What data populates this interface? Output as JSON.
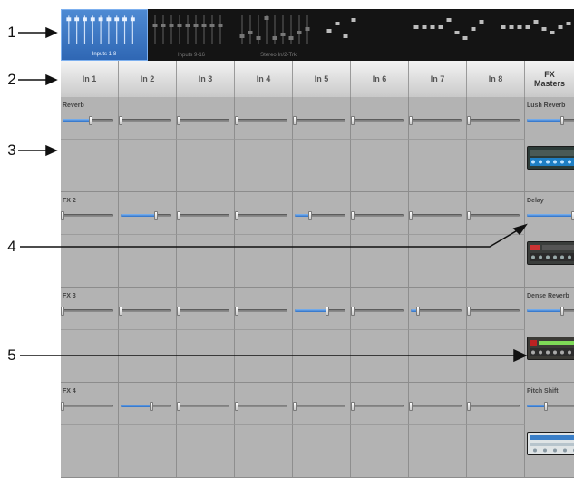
{
  "callouts": [
    "1",
    "2",
    "3",
    "4",
    "5"
  ],
  "tabs": [
    {
      "label": "Inputs 1-8",
      "active": true
    },
    {
      "label": "Inputs 9-16",
      "active": false
    },
    {
      "label": "Stereo In/2-Trk",
      "active": false
    },
    {
      "label": "",
      "active": false
    },
    {
      "label": "",
      "active": false
    },
    {
      "label": "",
      "active": false
    }
  ],
  "channels": [
    "In 1",
    "In 2",
    "In 3",
    "In 4",
    "In 5",
    "In 6",
    "In 7",
    "In 8"
  ],
  "fx_masters_header": {
    "line1": "FX",
    "line2": "Masters"
  },
  "fx_sections": [
    {
      "label": "Reverb",
      "sends": [
        0.55,
        0,
        0,
        0,
        0,
        0,
        0,
        0
      ],
      "master": {
        "name": "Lush Reverb",
        "level": 0.65
      }
    },
    {
      "label": "FX 2",
      "sends": [
        0,
        0.7,
        0,
        0,
        0.3,
        0,
        0,
        0
      ],
      "master": {
        "name": "Delay",
        "level": 0.85
      }
    },
    {
      "label": "FX 3",
      "sends": [
        0,
        0,
        0,
        0,
        0.65,
        0,
        0.15,
        0
      ],
      "master": {
        "name": "Dense Reverb",
        "level": 0.65
      }
    },
    {
      "label": "FX 4",
      "sends": [
        0,
        0.6,
        0,
        0,
        0,
        0,
        0,
        0
      ],
      "master": {
        "name": "Pitch Shift",
        "level": 0.35
      }
    }
  ],
  "colors": {
    "accent": "#2f67b4",
    "fill": "#4a8ad8"
  }
}
